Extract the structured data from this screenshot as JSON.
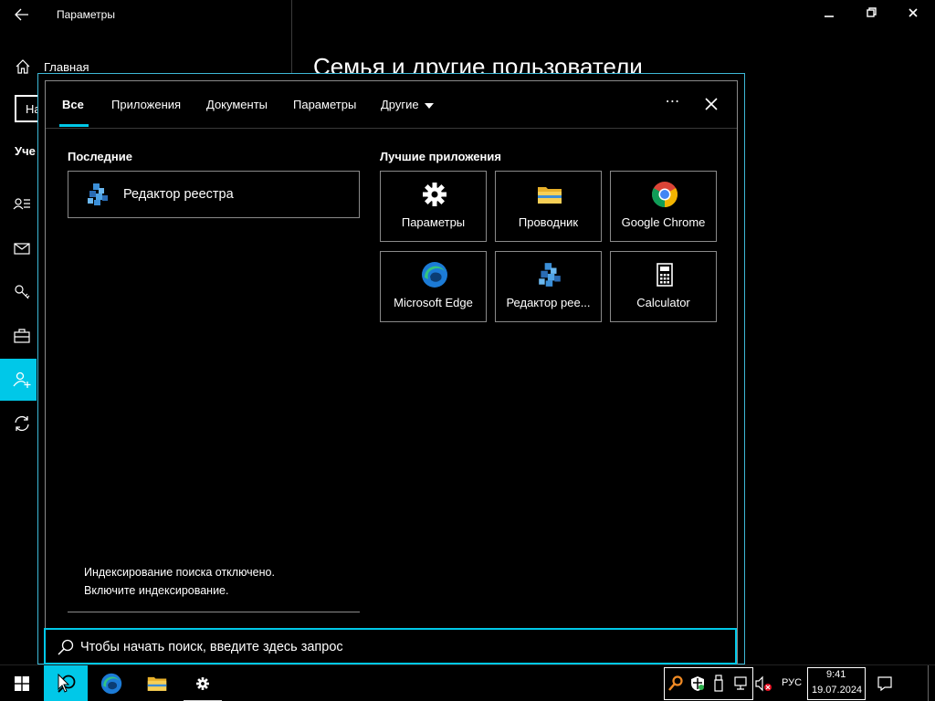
{
  "settings": {
    "title": "Параметры",
    "home_label": "Главная",
    "search_partial": "На",
    "section_partial": "Уче",
    "heading": "Семья и другие пользователи"
  },
  "search": {
    "tabs": [
      {
        "label": "Все",
        "active": true
      },
      {
        "label": "Приложения",
        "active": false
      },
      {
        "label": "Документы",
        "active": false
      },
      {
        "label": "Параметры",
        "active": false
      },
      {
        "label": "Другие",
        "active": false
      }
    ],
    "more_label": "⋯",
    "recent_title": "Последние",
    "recent_items": [
      {
        "label": "Редактор реестра",
        "icon": "registry-editor-icon"
      }
    ],
    "top_apps_title": "Лучшие приложения",
    "top_apps": [
      {
        "label": "Параметры",
        "icon": "gear-icon"
      },
      {
        "label": "Проводник",
        "icon": "file-explorer-icon"
      },
      {
        "label": "Google Chrome",
        "icon": "chrome-icon"
      },
      {
        "label": "Microsoft Edge",
        "icon": "edge-icon"
      },
      {
        "label": "Редактор рее...",
        "icon": "registry-editor-icon"
      },
      {
        "label": "Calculator",
        "icon": "calculator-icon"
      }
    ],
    "index_note_line1": "Индексирование поиска отключено.",
    "index_note_line2": "Включите индексирование.",
    "placeholder": "Чтобы начать поиск, введите здесь запрос"
  },
  "taskbar": {
    "language": "РУС",
    "time": "9:41",
    "date": "19.07.2024"
  },
  "colors": {
    "accent": "#00c8e8",
    "background": "#000000",
    "border": "#8a8a8a"
  }
}
